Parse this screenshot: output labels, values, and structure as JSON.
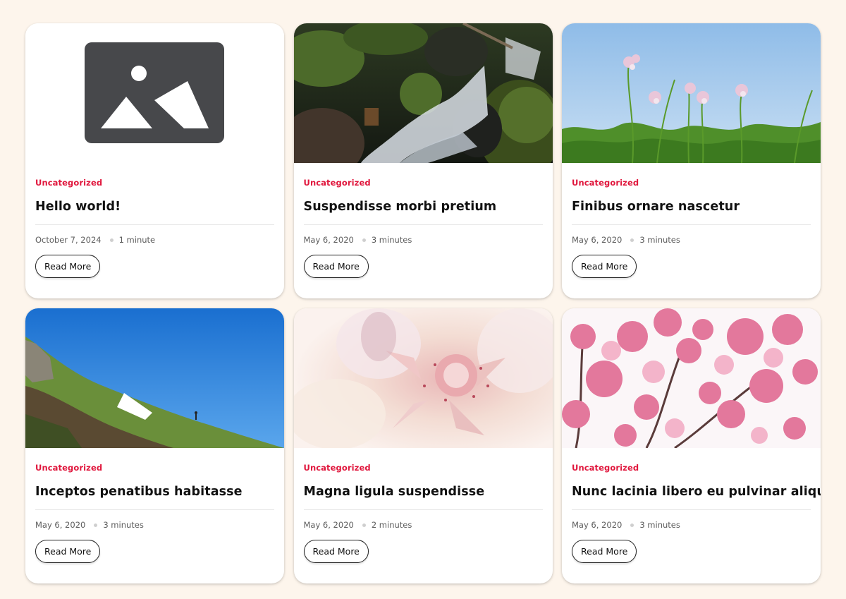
{
  "posts": [
    {
      "category": "Uncategorized",
      "title": "Hello world!",
      "date": "October 7, 2024",
      "read_time": "1 minute",
      "read_more": "Read More",
      "image": "placeholder-image-icon"
    },
    {
      "category": "Uncategorized",
      "title": "Suspendisse morbi pretium",
      "date": "May 6, 2020",
      "read_time": "3 minutes",
      "read_more": "Read More",
      "image": "waterfall-photo"
    },
    {
      "category": "Uncategorized",
      "title": "Finibus ornare nascetur",
      "date": "May 6, 2020",
      "read_time": "3 minutes",
      "read_more": "Read More",
      "image": "wildflowers-photo"
    },
    {
      "category": "Uncategorized",
      "title": "Inceptos penatibus habitasse",
      "date": "May 6, 2020",
      "read_time": "3 minutes",
      "read_more": "Read More",
      "image": "hillside-photo"
    },
    {
      "category": "Uncategorized",
      "title": "Magna ligula suspendisse",
      "date": "May 6, 2020",
      "read_time": "2 minutes",
      "read_more": "Read More",
      "image": "protea-flower-photo"
    },
    {
      "category": "Uncategorized",
      "title": "Nunc lacinia libero eu pulvinar aliquet",
      "date": "May 6, 2020",
      "read_time": "3 minutes",
      "read_more": "Read More",
      "image": "cherry-blossom-photo"
    }
  ],
  "colors": {
    "page_background": "#fdf5ec",
    "category_accent": "#e0163c",
    "card_background": "#ffffff"
  }
}
